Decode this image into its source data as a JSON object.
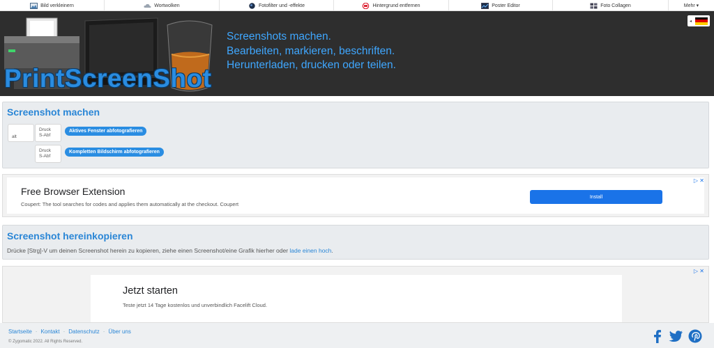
{
  "nav": {
    "items": [
      {
        "label": "Bild verkleinern",
        "icon": "image-icon"
      },
      {
        "label": "Wortwolken",
        "icon": "cloud-icon"
      },
      {
        "label": "Fotofilter und -effekte",
        "icon": "filter-icon"
      },
      {
        "label": "Hintergrund entfernen",
        "icon": "remove-background-icon"
      },
      {
        "label": "Poster Editor",
        "icon": "poster-icon"
      },
      {
        "label": "Foto Collagen",
        "icon": "collage-icon"
      },
      {
        "label": "Mehr ▾",
        "icon": ""
      }
    ]
  },
  "header": {
    "brand": "PrintScreenShot",
    "tagline": [
      "Screenshots machen.",
      "Bearbeiten, markieren, beschriften.",
      "Herunterladen, drucken oder teilen."
    ]
  },
  "screenshot": {
    "title": "Screenshot machen",
    "key_alt": "alt",
    "key_print": "Druck",
    "key_print2": "S-Abf",
    "btn_window": "Aktives Fenster abfotografieren",
    "btn_full": "Kompletten Bildschirm abfotografieren"
  },
  "ad1": {
    "title": "Free Browser Extension",
    "subtitle": "Coupert: The tool searches for codes and applies them automatically at the checkout. Coupert",
    "button": "Install"
  },
  "paste": {
    "title": "Screenshot hereinkopieren",
    "text": "Drücke [Strg]-V um deinen Screenshot herein zu kopieren, ziehe einen Screenshot/eine Grafik hierher oder ",
    "link": "lade einen hoch",
    "end": "."
  },
  "ad2": {
    "title": "Jetzt starten",
    "subtitle": "Teste jetzt 14 Tage kostenlos und unverbindlich Facelift Cloud."
  },
  "footer": {
    "links": [
      "Startseite",
      "Kontakt",
      "Datenschutz",
      "Über uns"
    ],
    "separator": "·",
    "copyright": "© Zygomatic 2022. All Rights Reserved."
  },
  "colors": {
    "accent": "#2a8de2",
    "header_bg": "#2e2e2e",
    "ad_button": "#1a73e8"
  }
}
